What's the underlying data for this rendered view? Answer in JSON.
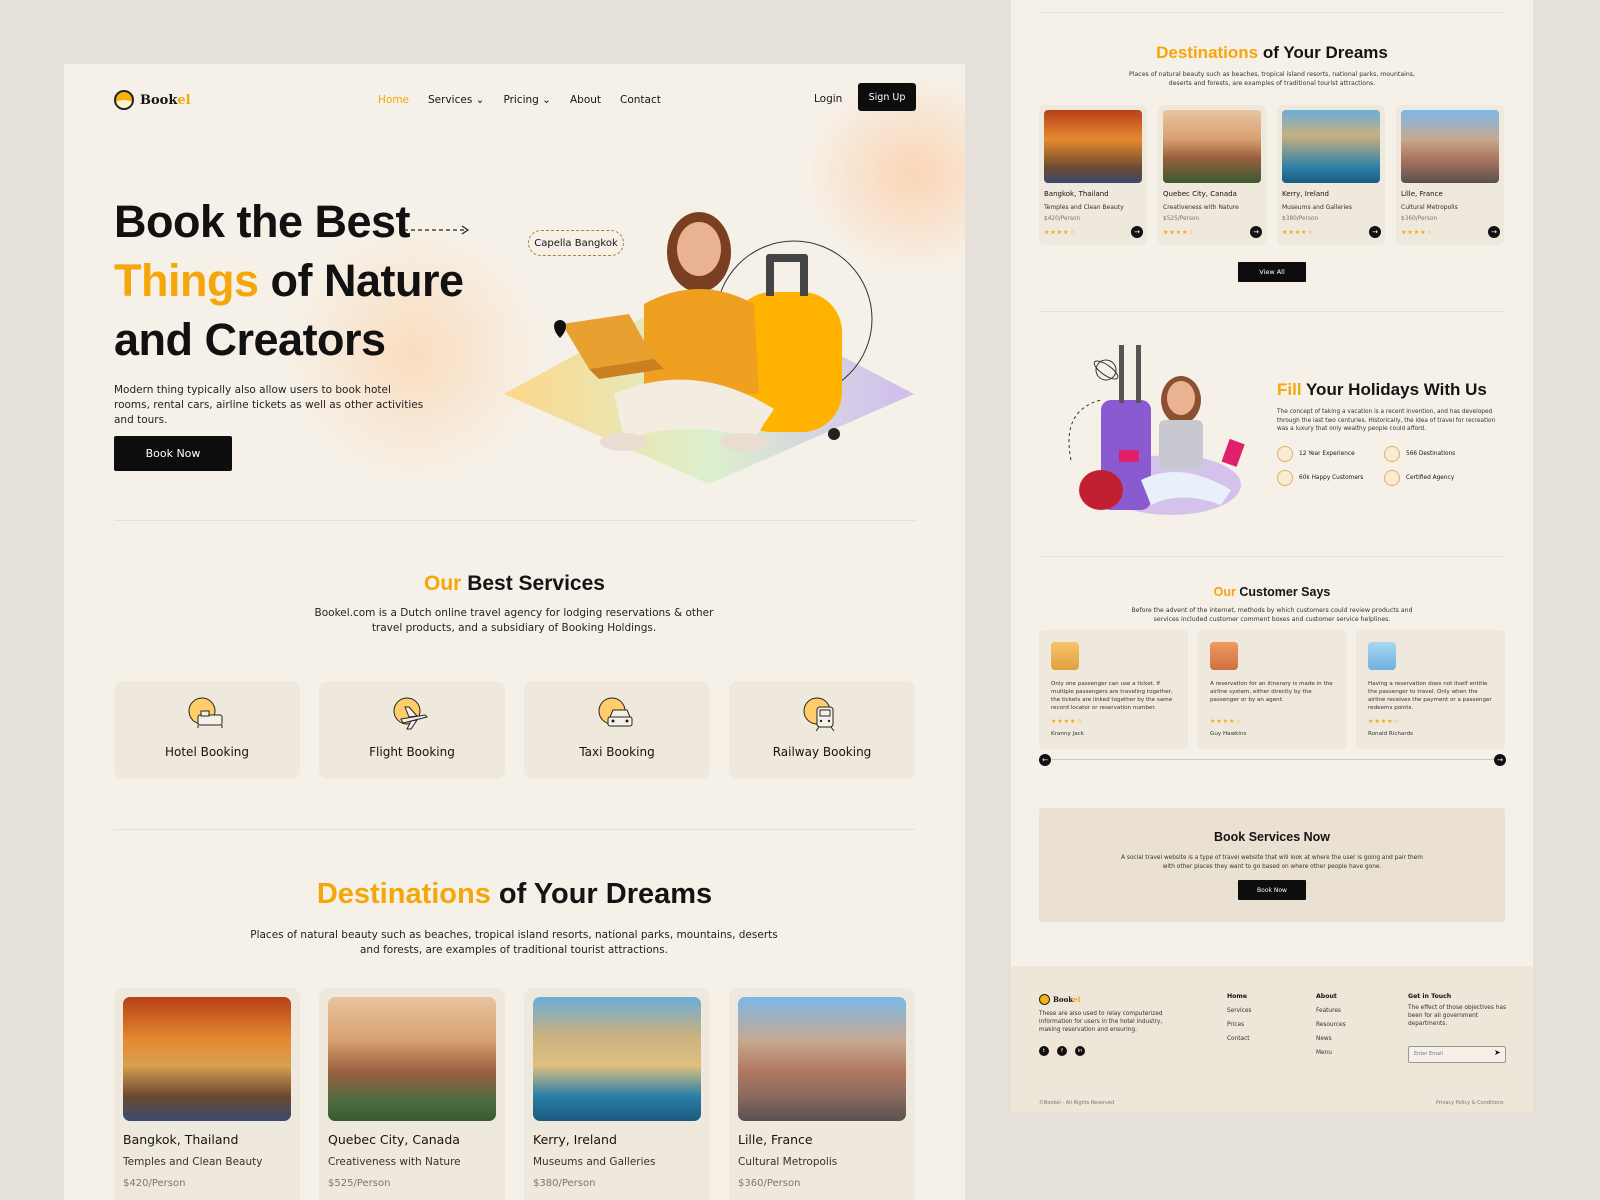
{
  "brand": {
    "name_main": "Book",
    "name_accent": "el"
  },
  "nav": {
    "items": [
      {
        "label": "Home",
        "active": true
      },
      {
        "label": "Services ⌄"
      },
      {
        "label": "Pricing ⌄"
      },
      {
        "label": "About"
      },
      {
        "label": "Contact"
      }
    ],
    "login": "Login",
    "signup": "Sign Up"
  },
  "hero": {
    "line1": "Book the Best",
    "line2_accent": "Things",
    "line2_rest": " of Nature",
    "line3": "and Creators",
    "subtitle": "Modern thing typically also allow users to book hotel rooms, rental cars, airline tickets as well as other activities and tours.",
    "cta": "Book Now",
    "location_tag": "Capella Bangkok"
  },
  "services": {
    "title_accent": "Our",
    "title_rest": " Best Services",
    "subtitle": "Bookel.com is a Dutch online travel agency for lodging reservations & other travel products, and a subsidiary of Booking Holdings.",
    "items": [
      {
        "label": "Hotel Booking",
        "icon": "bed-icon"
      },
      {
        "label": "Flight Booking",
        "icon": "airplane-icon"
      },
      {
        "label": "Taxi Booking",
        "icon": "taxi-icon"
      },
      {
        "label": "Railway Booking",
        "icon": "train-icon"
      }
    ]
  },
  "destinations": {
    "title_accent": "Destinations",
    "title_rest": " of Your Dreams",
    "subtitle": "Places of natural beauty such as beaches, tropical island resorts, national parks, mountains, deserts and forests, are examples of traditional tourist attractions.",
    "items": [
      {
        "name": "Bangkok, Thailand",
        "desc": "Temples and Clean Beauty",
        "price": "$420/Person",
        "rating": 4.5
      },
      {
        "name": "Quebec City, Canada",
        "desc": "Creativeness with Nature",
        "price": "$525/Person",
        "rating": 4.5
      },
      {
        "name": "Kerry, Ireland",
        "desc": "Museums and Galleries",
        "price": "$380/Person",
        "rating": 4.5
      },
      {
        "name": "Lille, France",
        "desc": "Cultural Metropolis",
        "price": "$360/Person",
        "rating": 4.5
      }
    ],
    "view_all": "View All"
  },
  "holidays": {
    "title_accent": "Fill",
    "title_rest": " Your Holidays With Us",
    "text": "The concept of taking a vacation is a recent invention, and has developed through the last two centuries. Historically, the idea of travel for recreation was a luxury that only wealthy people could afford.",
    "stats": [
      "12 Year Experience",
      "566 Destinations",
      "60k Happy Customers",
      "Certified Agency"
    ]
  },
  "testimonials": {
    "title_accent": "Our",
    "title_rest": " Customer Says",
    "subtitle": "Before the advent of the internet, methods by which customers could review products and services included customer comment boxes and customer service helplines.",
    "items": [
      {
        "text": "Only one passenger can use a ticket. If multiple passengers are traveling together, the tickets are linked together by the same record locator or reservation number.",
        "name": "Kranny Jack"
      },
      {
        "text": "A reservation for an itinerary is made in the airline system, either directly by the passenger or by an agent.",
        "name": "Guy Hawkins"
      },
      {
        "text": "Having a reservation does not itself entitle the passenger to travel. Only when the airline receives the payment or a passenger redeems points.",
        "name": "Ronald Richards"
      }
    ]
  },
  "cta_block": {
    "title": "Book Services Now",
    "text": "A social travel website is a type of travel website that will look at where the user is going and pair them with other places they want to go based on where other people have gone.",
    "button": "Book Now"
  },
  "footer": {
    "about": "These are also used to relay computerized information for users in the hotel industry, making reservation and ensuring.",
    "col1": {
      "head": "Home",
      "links": [
        "Services",
        "Prices",
        "Contact"
      ]
    },
    "col2": {
      "head": "About",
      "links": [
        "Features",
        "Resources",
        "News",
        "Menu"
      ]
    },
    "col3": {
      "head": "Get in Touch",
      "text": "The effect of those objectives has been for all government departments."
    },
    "email_placeholder": "Enter Email",
    "copyright": "©Bookel - All Rights Reserved",
    "legal": "Privacy Policy & Conditions"
  },
  "colors": {
    "accent": "#f5a60a",
    "dark": "#0d0d0d",
    "panel": "#f6f1e8",
    "card": "#efe8dc",
    "backdrop": "#e5e1da"
  }
}
